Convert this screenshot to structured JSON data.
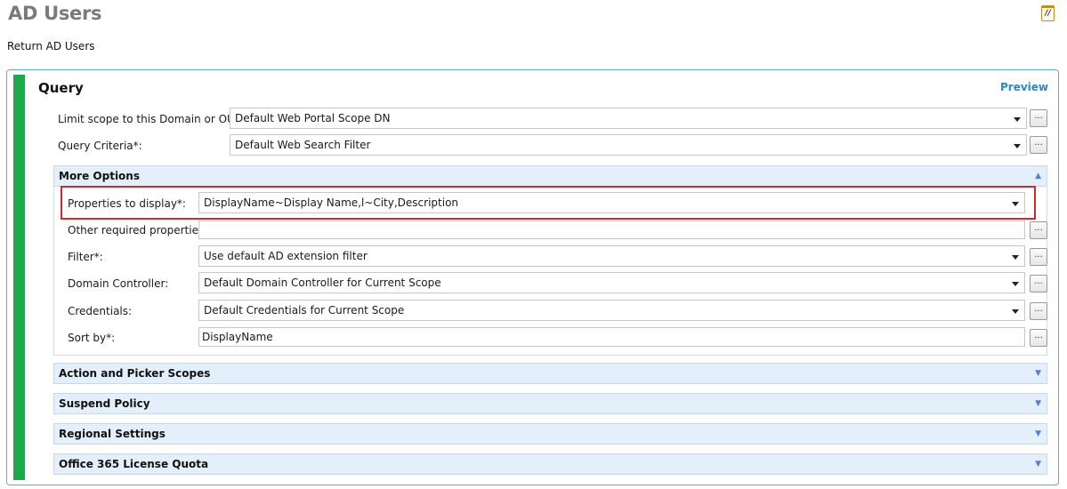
{
  "page": {
    "title": "AD Users",
    "subtitle": "Return AD Users"
  },
  "query": {
    "title": "Query",
    "preview_label": "Preview",
    "fields": {
      "scope": {
        "label": "Limit scope to this Domain or OU*:",
        "value": "Default Web Portal Scope DN"
      },
      "criteria": {
        "label": "Query Criteria*:",
        "value": "Default Web Search Filter"
      }
    },
    "browse_label": "..."
  },
  "more_options": {
    "title": "More Options",
    "expanded": true,
    "fields": {
      "properties": {
        "label": "Properties to display*:",
        "value": "DisplayName~Display Name,l~City,Description"
      },
      "other_required": {
        "label": "Other required properties:",
        "value": ""
      },
      "filter": {
        "label": "Filter*:",
        "value": "Use default AD extension filter"
      },
      "domain_controller": {
        "label": "Domain Controller:",
        "value": "Default Domain Controller for Current Scope"
      },
      "credentials": {
        "label": "Credentials:",
        "value": "Default Credentials for Current Scope"
      },
      "sort_by": {
        "label": "Sort by*:",
        "value": "DisplayName"
      }
    }
  },
  "collapsed_groups": [
    {
      "title": "Action and Picker Scopes"
    },
    {
      "title": "Suspend Policy"
    },
    {
      "title": "Regional Settings"
    },
    {
      "title": "Office 365 License Quota"
    }
  ],
  "icons": {
    "notes": "notes-icon",
    "collapse": "chevron-up-icon",
    "expand": "chevron-down-icon"
  },
  "colors": {
    "accent_green": "#1aaa4a",
    "link_blue": "#2b86c8",
    "highlight_red": "#d9262c",
    "group_header_bg": "#e3effb"
  }
}
